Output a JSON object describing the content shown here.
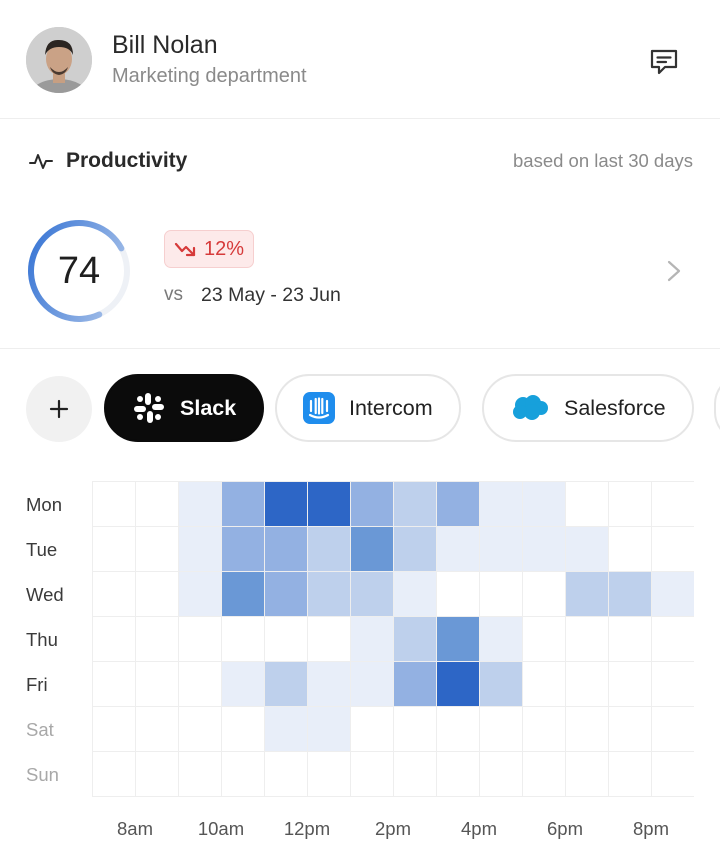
{
  "profile": {
    "name": "Bill Nolan",
    "department": "Marketing department"
  },
  "section": {
    "title": "Productivity",
    "basis": "based on last 30 days"
  },
  "score": {
    "value": "74",
    "progress": 0.74,
    "change": "12%",
    "vs_label": "vs",
    "range": "23 May - 23 Jun"
  },
  "apps": [
    {
      "label": "Slack",
      "icon": "slack-icon",
      "active": true
    },
    {
      "label": "Intercom",
      "icon": "intercom-icon",
      "active": false
    },
    {
      "label": "Salesforce",
      "icon": "salesforce-icon",
      "active": false
    }
  ],
  "colors": {
    "accent": "#2f6fd3",
    "negative": "#d63a3a",
    "chip_active": "#0b0b0b"
  },
  "heatmap": {
    "days": [
      "Mon",
      "Tue",
      "Wed",
      "Thu",
      "Fri",
      "Sat",
      "Sun"
    ],
    "hour_labels": [
      "8am",
      "10am",
      "12pm",
      "2pm",
      "4pm",
      "6pm",
      "8pm"
    ],
    "levels": [
      [
        0,
        0,
        1,
        3,
        5,
        5,
        3,
        2,
        3,
        1,
        1,
        0,
        0,
        0
      ],
      [
        0,
        0,
        1,
        3,
        3,
        2,
        4,
        2,
        1,
        1,
        1,
        1,
        0,
        0
      ],
      [
        0,
        0,
        1,
        4,
        3,
        2,
        2,
        1,
        0,
        0,
        0,
        2,
        2,
        1
      ],
      [
        0,
        0,
        0,
        0,
        0,
        0,
        1,
        2,
        4,
        1,
        0,
        0,
        0,
        0
      ],
      [
        0,
        0,
        0,
        1,
        2,
        1,
        1,
        3,
        5,
        2,
        0,
        0,
        0,
        0
      ],
      [
        0,
        0,
        0,
        0,
        1,
        1,
        0,
        0,
        0,
        0,
        0,
        0,
        0,
        0
      ],
      [
        0,
        0,
        0,
        0,
        0,
        0,
        0,
        0,
        0,
        0,
        0,
        0,
        0,
        0
      ]
    ]
  }
}
